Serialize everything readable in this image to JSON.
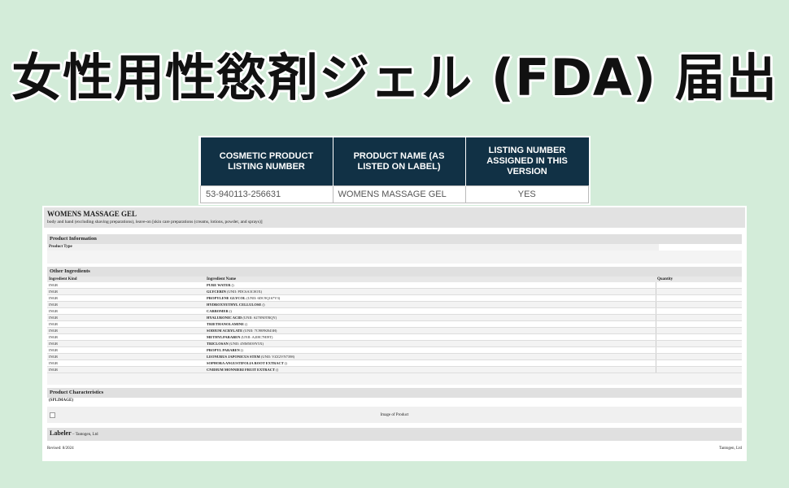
{
  "banner": {
    "title": "女性用性慾剤ジェル (FDA) 届出"
  },
  "listing_table": {
    "headers": [
      "COSMETIC PRODUCT LISTING NUMBER",
      "PRODUCT NAME (AS LISTED ON LABEL)",
      "LISTING NUMBER ASSIGNED IN THIS VERSION"
    ],
    "row": [
      "53-940113-256631",
      "WOMENS MASSAGE GEL",
      "YES"
    ]
  },
  "document": {
    "title": "WOMENS MASSAGE GEL",
    "subtitle": "body and hand (excluding shaving preparations), leave-on [skin care preparations (creams, lotions, powder, and sprays)]",
    "product_information": {
      "heading": "Product Information",
      "product_type_label": "Product Type"
    },
    "other_ingredients": {
      "heading": "Other Ingredients",
      "columns": [
        "Ingredient Kind",
        "Ingredient Name",
        "Quantity"
      ],
      "rows": [
        {
          "kind": "INGR",
          "name": "PURE WATER",
          "unii": "()"
        },
        {
          "kind": "INGR",
          "name": "GLYCERIN",
          "unii": "(UNII: PDC6A3C0OX)"
        },
        {
          "kind": "INGR",
          "name": "PROPYLENE GLYCOL",
          "unii": "(UNII: 6DC9Q167V3)"
        },
        {
          "kind": "INGR",
          "name": "HYDROXYETHYL CELLULOSE",
          "unii": "()"
        },
        {
          "kind": "INGR",
          "name": "CARBOMER",
          "unii": "()"
        },
        {
          "kind": "INGR",
          "name": "HYALURONIC ACID",
          "unii": "(UNII: S270N0TRQY)"
        },
        {
          "kind": "INGR",
          "name": "TRIETHANOLAMINE",
          "unii": "()"
        },
        {
          "kind": "INGR",
          "name": "SODIUM ACRYLATE",
          "unii": "(UNII: 7C98FKB43H)"
        },
        {
          "kind": "INGR",
          "name": "METHYLPARABEN",
          "unii": "(UNII: A2I8C7HI9T)"
        },
        {
          "kind": "INGR",
          "name": "TRICLOSAN",
          "unii": "(UNII: 4NM5039Y5X)"
        },
        {
          "kind": "INGR",
          "name": "PROPYL PARABEN",
          "unii": "()"
        },
        {
          "kind": "INGR",
          "name": "LEONURUS JAPONICUS STEM",
          "unii": "(UNII: VZZ2VN7398)"
        },
        {
          "kind": "INGR",
          "name": "SOPHORA ANGUSTIFOLIA ROOT EXTRACT",
          "unii": "()"
        },
        {
          "kind": "INGR",
          "name": "CNIDIUM MONNIERI FRUIT EXTRACT",
          "unii": "()"
        }
      ]
    },
    "product_characteristics": {
      "heading": "Product Characteristics",
      "value": "(SPLIMAGE)"
    },
    "image_caption": "Image of Product",
    "labeler": {
      "label": "Labeler",
      "name": " – Tantogen, Ltd"
    },
    "footer": {
      "revised": "Revised: 8/2024",
      "company": "Tantogen, Ltd"
    }
  }
}
